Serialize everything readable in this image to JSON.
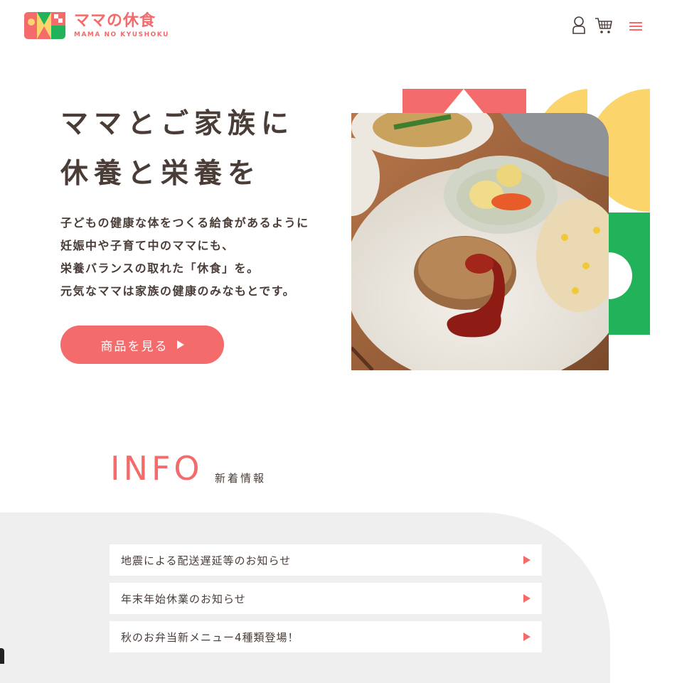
{
  "header": {
    "logo_jp": "ママの休食",
    "logo_en": "MAMA NO KYUSHOKU",
    "user_icon": "user-icon",
    "cart_icon": "cart-icon",
    "menu_icon": "hamburger-menu-icon"
  },
  "hero": {
    "title_line1": "ママとご家族に",
    "title_line2": "休養と栄養を",
    "desc": [
      "子どもの健康な体をつくる給食があるように",
      "妊娠中や子育て中のママにも、",
      "栄養バランスの取れた「休食」を。",
      "元気なママは家族の健康のみなもとです。"
    ],
    "cta_label": "商品を見る"
  },
  "info": {
    "title": "INFO",
    "subtitle": "新着情報",
    "items": [
      {
        "label": "地震による配送遅延等のお知らせ"
      },
      {
        "label": "年末年始休業のお知らせ"
      },
      {
        "label": "秋のお弁当新メニュー4種類登場！"
      }
    ]
  },
  "colors": {
    "accent": "#f36b6b",
    "yellow": "#fbd46b",
    "green": "#22b35a",
    "text": "#4a3d38",
    "info_bg": "#efefef"
  }
}
